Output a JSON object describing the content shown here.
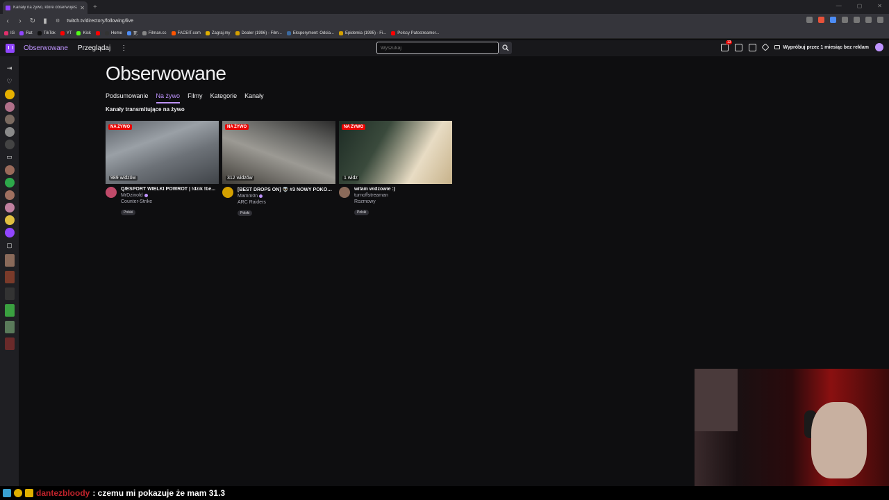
{
  "browser": {
    "tab_title": "Kanały na żywo, które obserwujesz",
    "url": "twitch.tv/directory/following/live",
    "bookmarks": [
      "IG",
      "Rat",
      "TikTok",
      "YT",
      "Kick",
      "",
      "Home",
      "",
      "死",
      "Filman.cc",
      "FACEIT.com",
      "Zagraj.my",
      "Dealer (1996) - Film...",
      "Eksperyment: Odsia...",
      "Epidemia (1995) - Fi...",
      "Polscy Patostreamer..."
    ]
  },
  "topnav": {
    "following": "Obserwowane",
    "browse": "Przeglądaj",
    "more": "⋮",
    "search_placeholder": "Wyszukaj",
    "notif_count": "13",
    "promo": "Wypróbuj przez 1 miesiąc bez reklam"
  },
  "main": {
    "title": "Obserwowane",
    "tabs": [
      "Podsumowanie",
      "Na żywo",
      "Filmy",
      "Kategorie",
      "Kanały"
    ],
    "active_tab": "Na żywo",
    "section_title": "Kanały transmitujące na żywo"
  },
  "cards": [
    {
      "live": "NA ŻYWO",
      "viewers": "989 widzów",
      "title": "Q/ESPORT WIELKI POWRÓT | !dzik !be...",
      "channel": "MrDzinold",
      "category": "Counter-Strike",
      "tag": "Polski"
    },
    {
      "live": "NA ŻYWO",
      "viewers": "312 widzów",
      "title": "[BEST DROPS ON] 👽 #3 NOWY POKÓJ ...",
      "channel": "Mamm0n",
      "category": "ARC Raiders",
      "tag": "Polski"
    },
    {
      "live": "NA ŻYWO",
      "viewers": "1 widz",
      "title": "witam widzowie :)",
      "channel": "turnoffstreaman",
      "category": "Rozmowy",
      "tag": "Polski"
    }
  ],
  "chat": {
    "user": "dantezbloody",
    "message": ": czemu mi pokazuje że mam 31.3"
  },
  "colors": {
    "accent": "#bf94ff",
    "live": "#eb0400",
    "chat_user": "#c0232b"
  }
}
